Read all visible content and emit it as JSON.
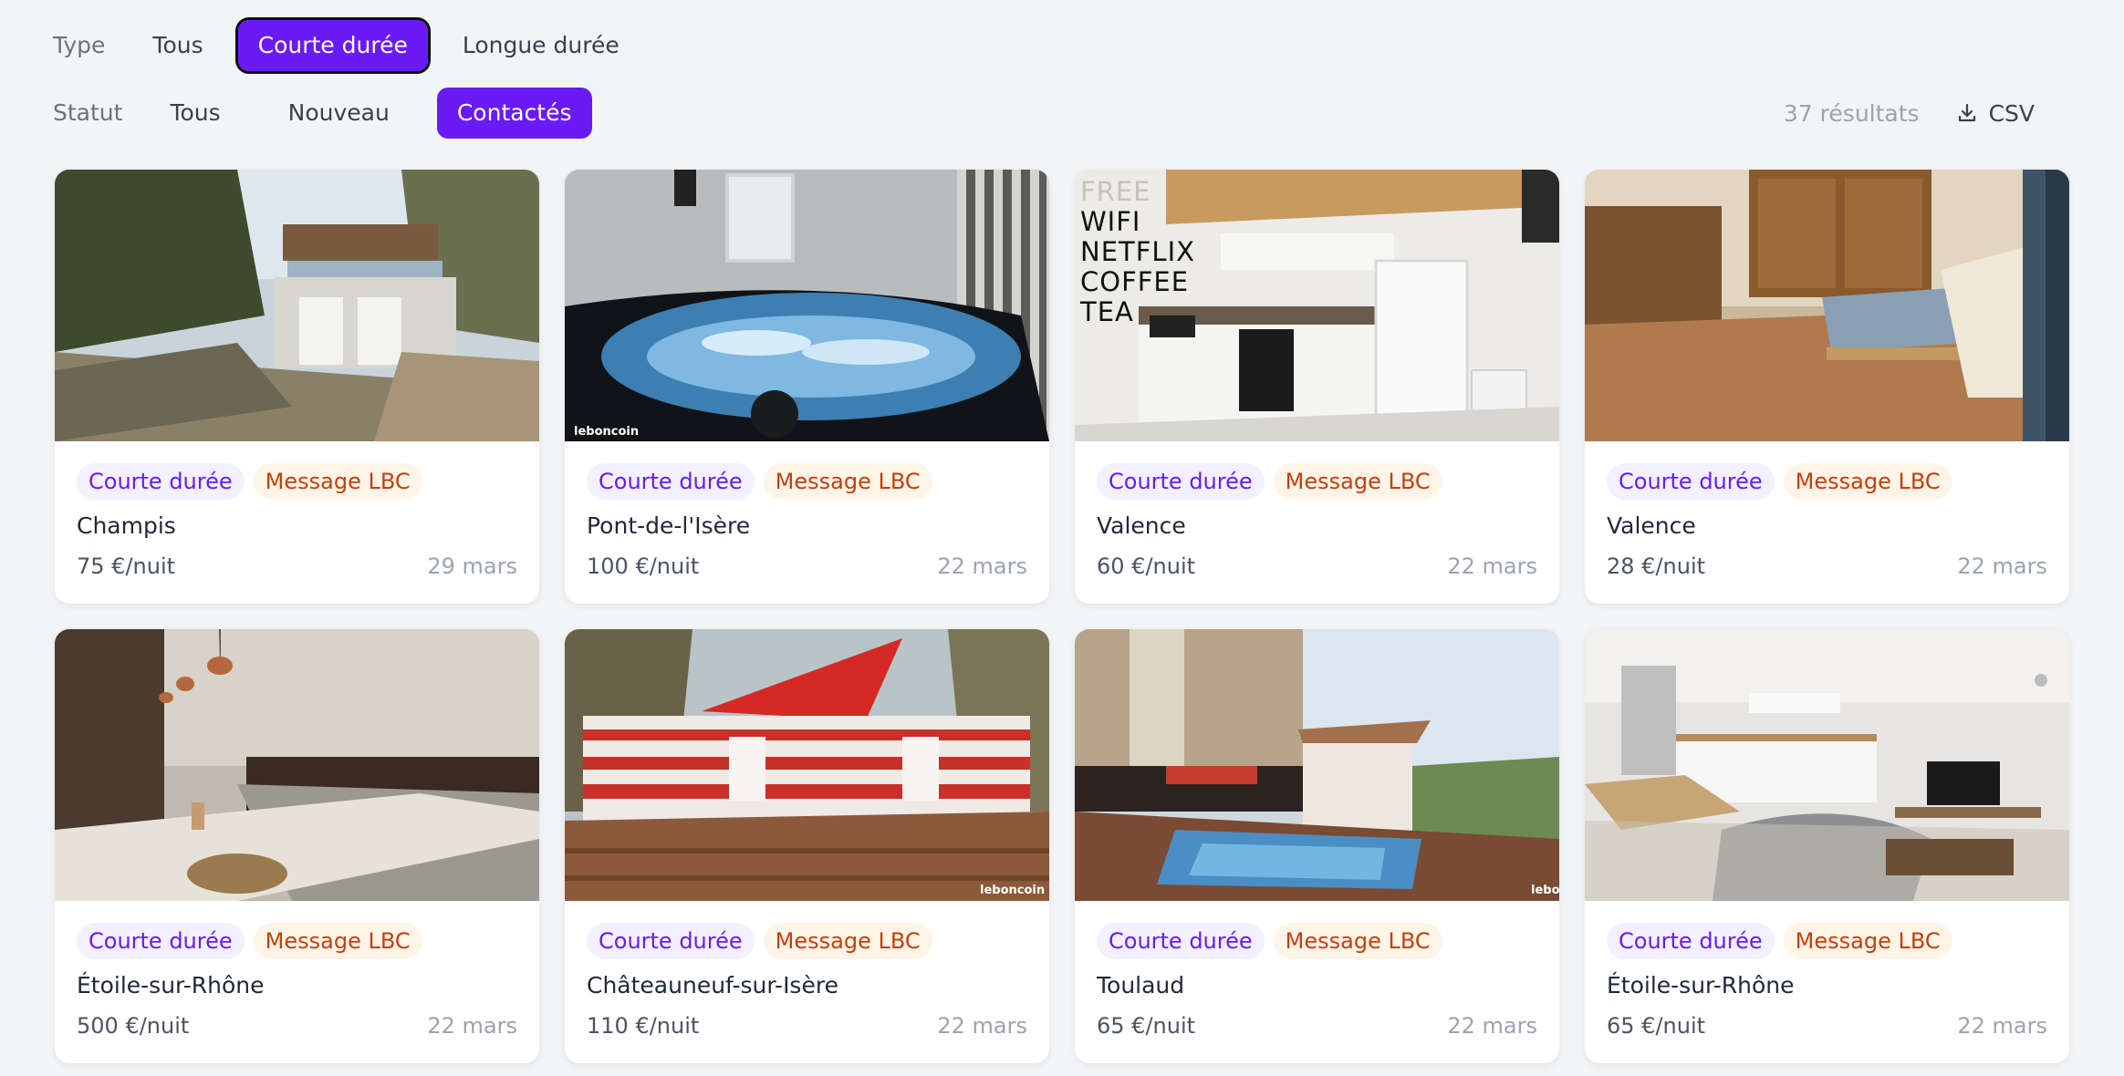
{
  "filters": {
    "type": {
      "label": "Type",
      "options": [
        "Tous",
        "Courte durée",
        "Longue durée"
      ],
      "selected": "Courte durée"
    },
    "statut": {
      "label": "Statut",
      "options": [
        "Tous",
        "Nouveau",
        "Contactés"
      ],
      "selected": "Contactés"
    }
  },
  "results": {
    "count": "37 résultats",
    "export_label": "CSV",
    "export_icon": "download-icon"
  },
  "colors": {
    "accent": "#6a1bf5",
    "tag_duration_bg": "#f3f0ff",
    "tag_message_bg": "#fff4e8",
    "tag_message_text": "#c2410c"
  },
  "listings": [
    {
      "tags": [
        "Courte durée",
        "Message LBC"
      ],
      "city": "Champis",
      "price": "75 €/nuit",
      "date": "29 mars",
      "image": "stone-house-garages-photo"
    },
    {
      "tags": [
        "Courte durée",
        "Message LBC"
      ],
      "city": "Pont-de-l'Isère",
      "price": "100 €/nuit",
      "date": "22 mars",
      "image": "jacuzzi-photo",
      "watermark": "leboncoin"
    },
    {
      "tags": [
        "Courte durée",
        "Message LBC"
      ],
      "city": "Valence",
      "price": "60 €/nuit",
      "date": "22 mars",
      "image": "kitchen-photo",
      "overlay_text": [
        "FREE",
        "WIFI",
        "NETFLIX",
        "COFFEE",
        "TEA"
      ]
    },
    {
      "tags": [
        "Courte durée",
        "Message LBC"
      ],
      "city": "Valence",
      "price": "28 €/nuit",
      "date": "22 mars",
      "image": "living-room-wood-photo"
    },
    {
      "tags": [
        "Courte durée",
        "Message LBC"
      ],
      "city": "Étoile-sur-Rhône",
      "price": "500 €/nuit",
      "date": "22 mars",
      "image": "long-kitchen-photo"
    },
    {
      "tags": [
        "Courte durée",
        "Message LBC"
      ],
      "city": "Châteauneuf-sur-Isère",
      "price": "110 €/nuit",
      "date": "22 mars",
      "image": "mobile-home-terrace-photo",
      "watermark": "leboncoin"
    },
    {
      "tags": [
        "Courte durée",
        "Message LBC"
      ],
      "city": "Toulaud",
      "price": "65 €/nuit",
      "date": "22 mars",
      "image": "pool-terrace-photo",
      "watermark": "lebo"
    },
    {
      "tags": [
        "Courte durée",
        "Message LBC"
      ],
      "city": "Étoile-sur-Rhône",
      "price": "65 €/nuit",
      "date": "22 mars",
      "image": "open-living-room-photo"
    }
  ]
}
